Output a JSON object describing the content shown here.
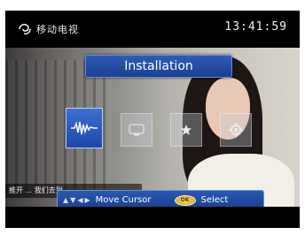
{
  "header": {
    "channel_name": "移动电视",
    "clock": "13:41:59"
  },
  "menu": {
    "title": "Installation",
    "tiles": [
      {
        "icon": "waveform-icon",
        "selected": true
      },
      {
        "icon": "display-icon",
        "selected": false
      },
      {
        "icon": "star-icon",
        "selected": false
      },
      {
        "icon": "gear-icon",
        "selected": false
      }
    ]
  },
  "overlay": {
    "subtitle_text": "推开 ... 我们去到..."
  },
  "hint_bar": {
    "arrow_up": "▲",
    "arrow_down": "▼",
    "arrow_left": "◀",
    "arrow_right": "▶",
    "move_label": "Move Cursor",
    "ok_label": "OK",
    "select_label": "Select"
  },
  "colors": {
    "panel_blue": "#1d49a6",
    "highlight_blue": "#3d6fd2",
    "ok_yellow": "#e8c24a"
  }
}
